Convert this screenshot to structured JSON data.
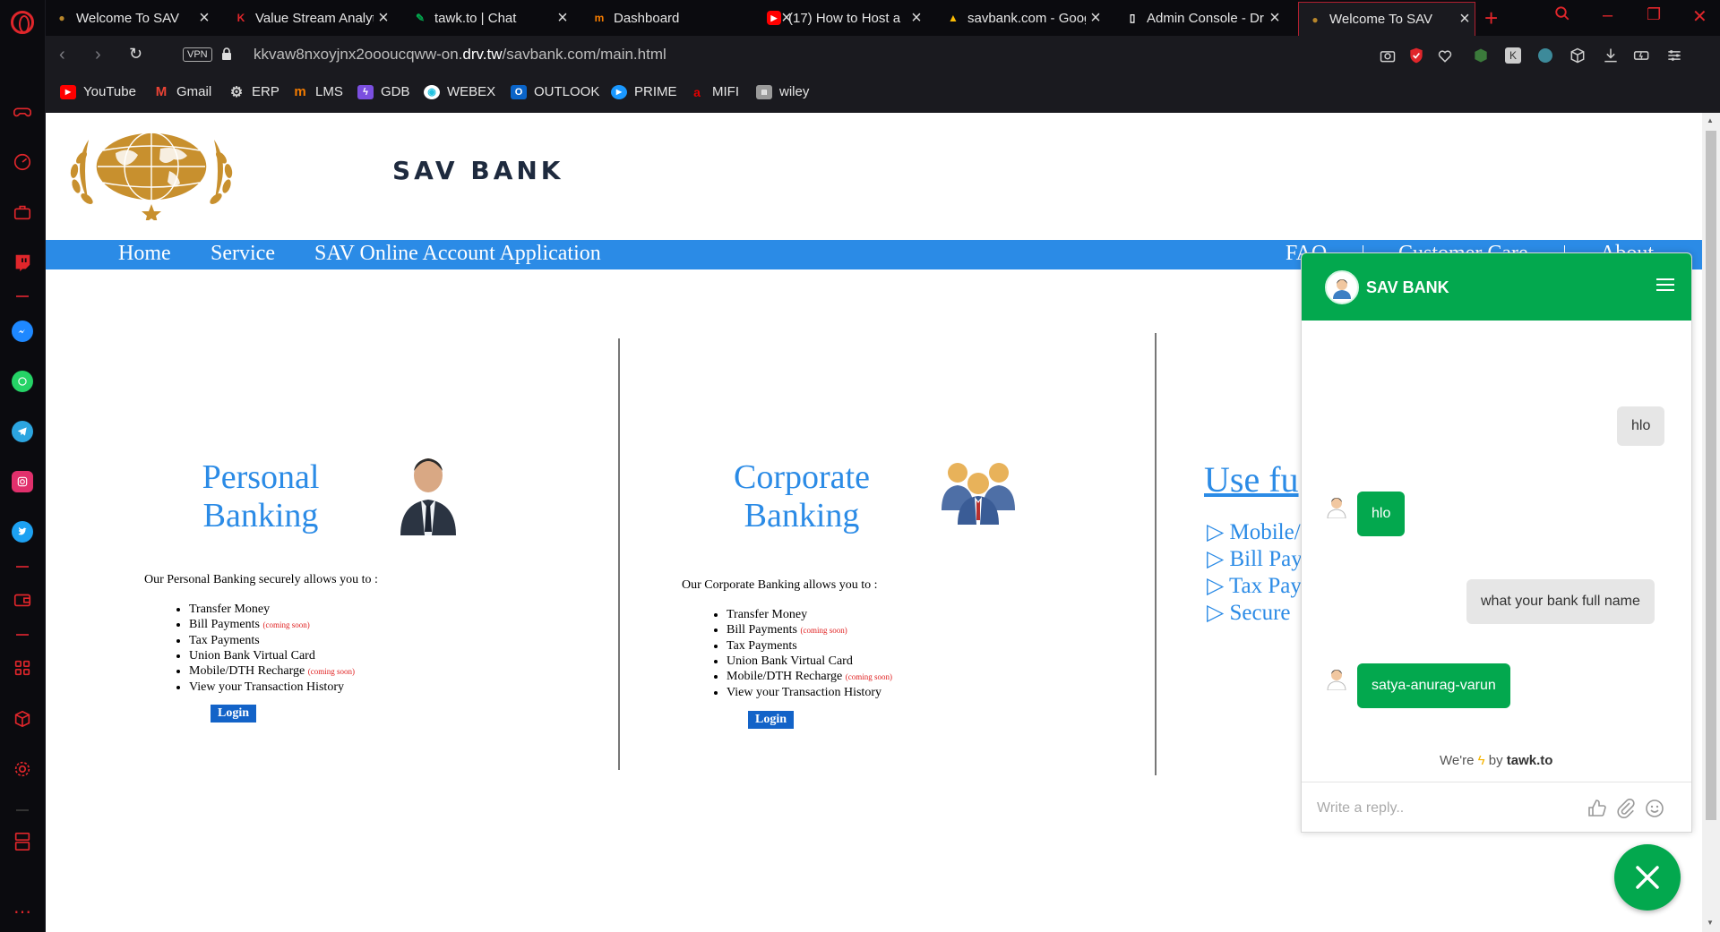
{
  "browser": {
    "tabs": [
      {
        "title": "Welcome To SAV",
        "favicon": "sav-logo"
      },
      {
        "title": "Value Stream Analyti",
        "favicon": "k-logo"
      },
      {
        "title": "tawk.to | Chat",
        "favicon": "tawk-logo"
      },
      {
        "title": "Dashboard",
        "favicon": "m-logo"
      },
      {
        "title": "(17) How to Host a",
        "favicon": "youtube-logo"
      },
      {
        "title": "savbank.com - Goog",
        "favicon": "google-drive-logo"
      },
      {
        "title": "Admin Console - Dr",
        "favicon": "document-logo"
      },
      {
        "title": "Welcome To SAV",
        "favicon": "sav-logo",
        "active": true
      }
    ],
    "address": {
      "vpn_label": "VPN",
      "url_prefix": "kkvaw8nxoyjnx2ooоucqww-on.",
      "url_domain": "drv.tw",
      "url_path": "/savbank.com/main.html"
    },
    "bookmarks": [
      {
        "label": "YouTube",
        "icon": "youtube-icon",
        "color": "#ff0000"
      },
      {
        "label": "Gmail",
        "icon": "gmail-icon",
        "color": "#ea4335"
      },
      {
        "label": "ERP",
        "icon": "gear-icon",
        "color": "#cfcfcf"
      },
      {
        "label": "LMS",
        "icon": "lms-icon",
        "color": "#f57c00"
      },
      {
        "label": "GDB",
        "icon": "lightning-icon",
        "color": "#7b4fe0"
      },
      {
        "label": "WEBEX",
        "icon": "webex-icon",
        "color": "#22c2e0"
      },
      {
        "label": "OUTLOOK",
        "icon": "outlook-icon",
        "color": "#0a64c8"
      },
      {
        "label": "PRIME",
        "icon": "prime-icon",
        "color": "#1a98ff"
      },
      {
        "label": "MIFI",
        "icon": "airtel-icon",
        "color": "#e40000"
      },
      {
        "label": "wiley",
        "icon": "wiley-icon",
        "color": "#9a9a9a"
      }
    ]
  },
  "site": {
    "bank_name": "SAV BANK",
    "nav": [
      "Home",
      "Service",
      "SAV Online Account Application"
    ],
    "nav_right": [
      "FAQ",
      "Customer Care",
      "About"
    ],
    "personal": {
      "title_line1": "Personal",
      "title_line2": "Banking",
      "intro": "Our Personal Banking securely allows you to :",
      "items": [
        "Transfer Money",
        "Bill Payments",
        "Tax Payments",
        "Union Bank Virtual Card",
        "Mobile/DTH Recharge",
        "View your Transaction History"
      ],
      "coming_soon": "(coming soon)",
      "login": "Login"
    },
    "corporate": {
      "title_line1": "Corporate",
      "title_line2": "Banking",
      "intro": "Our Corporate Banking allows you to :",
      "items": [
        "Transfer Money",
        "Bill Payments",
        "Tax Payments",
        "Union Bank Virtual Card",
        "Mobile/DTH Recharge",
        "View your Transaction History"
      ],
      "coming_soon": "(coming soon)",
      "login": "Login"
    },
    "useful": {
      "title": "Use fu",
      "items": [
        "▷ Mobile/",
        "▷ Bill Pay",
        "▷ Tax Pay",
        "▷ Secure"
      ]
    }
  },
  "chat": {
    "title": "SAV BANK",
    "messages": [
      {
        "from": "visitor",
        "text": "hlo"
      },
      {
        "from": "agent",
        "text": "hlo"
      },
      {
        "from": "visitor",
        "text": "what your bank full name"
      },
      {
        "from": "agent",
        "text": "satya-anurag-varun"
      }
    ],
    "powered_prefix": "We're",
    "powered_suffix": "by",
    "powered_brand": "tawk.to",
    "reply_placeholder": "Write a reply..",
    "accent": "#03a84e"
  }
}
